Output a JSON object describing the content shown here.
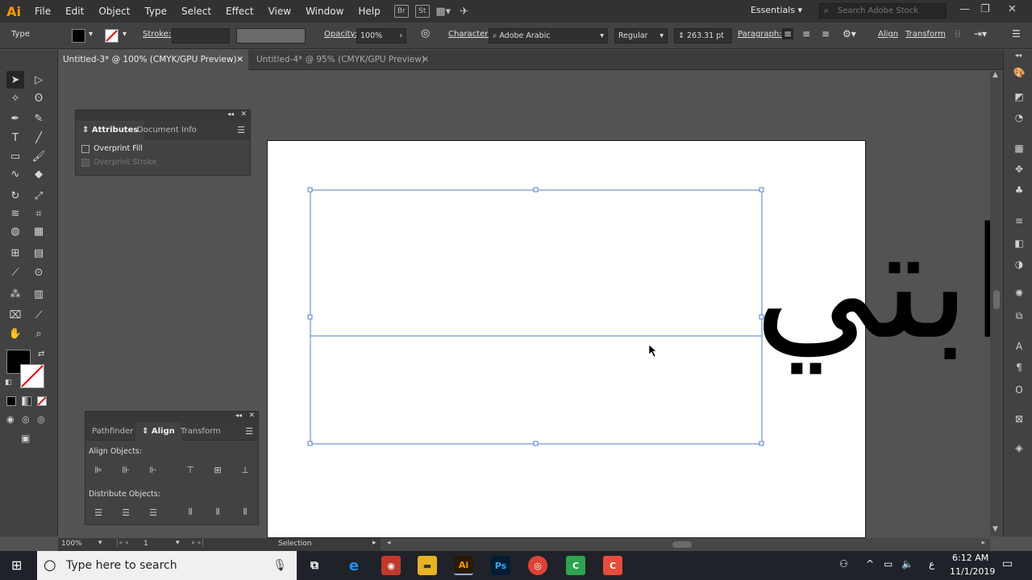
{
  "menubar": {
    "app_logo": "Ai",
    "items": [
      "File",
      "Edit",
      "Object",
      "Type",
      "Select",
      "Effect",
      "View",
      "Window",
      "Help"
    ],
    "bridge": "Br",
    "stock": "St",
    "workspace": "Essentials",
    "search_placeholder": "Search Adobe Stock"
  },
  "controlbar": {
    "type_label": "Type",
    "stroke_label": "Stroke:",
    "opacity_label": "Opacity:",
    "opacity_value": "100%",
    "character_label": "Character:",
    "font_name": "Adobe Arabic",
    "font_style": "Regular",
    "font_size": "263.31 pt",
    "paragraph_label": "Paragraph:",
    "align_label": "Align",
    "transform_label": "Transform"
  },
  "tabs": [
    {
      "label": "Untitled-3* @ 100% (CMYK/GPU Preview)"
    },
    {
      "label": "Untitled-4* @ 95% (CMYK/GPU Preview)"
    }
  ],
  "attributes_panel": {
    "tabs": [
      "Attributes",
      "Document Info"
    ],
    "overprint_fill": "Overprint Fill",
    "overprint_stroke": "Overprint Stroke"
  },
  "align_panel": {
    "tabs": [
      "Pathfinder",
      "Align",
      "Transform"
    ],
    "align_objects_label": "Align Objects:",
    "distribute_objects_label": "Distribute Objects:"
  },
  "canvas": {
    "arabic_text": "ابتي"
  },
  "statusbar": {
    "zoom": "100%",
    "artboard_number": "1",
    "tool_name": "Selection"
  },
  "taskbar": {
    "search_placeholder": "Type here to search",
    "time": "6:12 AM",
    "date": "11/1/2019",
    "lang": "ع"
  },
  "colors": {
    "accent_ai": "#ff9a00",
    "selection": "#4f7fd0"
  }
}
